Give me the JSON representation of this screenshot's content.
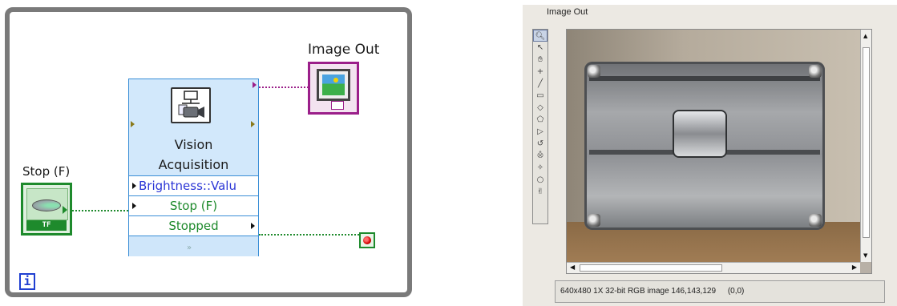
{
  "diagram": {
    "stop_control_label": "Stop (F)",
    "stop_control_tf": "TF",
    "image_out_label": "Image Out",
    "loop_iteration": "i",
    "express_vi": {
      "title_line1": "Vision",
      "title_line2": "Acquisition",
      "terminals": [
        "Brightness::Valu",
        "Stop (F)",
        "Stopped"
      ],
      "expand_glyph": "»"
    }
  },
  "display": {
    "label": "Image Out",
    "tools": [
      "zoom-tool",
      "pointer-tool",
      "pan-tool",
      "point-tool",
      "line-tool",
      "rectangle-tool",
      "oval-tool",
      "polygon-tool",
      "freehand-tool",
      "annulus-tool",
      "broken-line-tool",
      "freehand-region-tool",
      "ring-tool",
      "hand-tool"
    ],
    "status": {
      "info": "640x480 1X 32-bit RGB image 146,143,129",
      "coords": "(0,0)"
    }
  },
  "colors": {
    "boolean_green": "#1e8a2c",
    "image_purple": "#9b1f8a",
    "loop_gray": "#7a7a7a",
    "vi_blue": "#3a8ed6",
    "int_blue": "#1f3fd1"
  }
}
